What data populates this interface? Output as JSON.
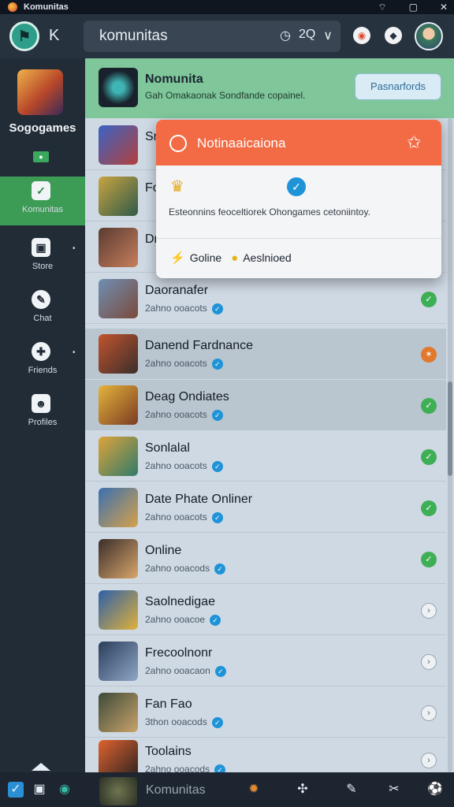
{
  "titlebar": {
    "title": "Komunitas",
    "controls": [
      "wifi-icon",
      "restore-icon",
      "close-icon"
    ]
  },
  "header": {
    "back_label": "K",
    "search_text": "komunitas",
    "search_icons": [
      "clock-icon",
      "2Q",
      "chevron-down-icon"
    ]
  },
  "sidebar": {
    "game_title": "Sogogames",
    "nav": [
      {
        "label": "Komunitas",
        "icon": "check-icon",
        "active": true
      },
      {
        "label": "Store",
        "icon": "store-icon",
        "active": false
      },
      {
        "label": "Chat",
        "icon": "chat-icon",
        "active": false
      },
      {
        "label": "Friends",
        "icon": "friends-icon",
        "active": false
      },
      {
        "label": "Profiles",
        "icon": "profile-icon",
        "active": false
      }
    ]
  },
  "top_card": {
    "title": "Nomunita",
    "subtitle": "Gah Omakaonak Sondfande copainel.",
    "button": "Pasnarfords"
  },
  "list": [
    {
      "name": "Sr",
      "sub": "",
      "status": "none"
    },
    {
      "name": "Fo",
      "sub": "",
      "status": "none"
    },
    {
      "name": "Dr",
      "sub": "",
      "status": "none"
    },
    {
      "name": "Daoranafer",
      "sub": "2ahno ooacots",
      "status": "on"
    },
    {
      "name": "Danend Fardnance",
      "sub": "2ahno ooacots",
      "status": "warn"
    },
    {
      "name": "Deag Ondiates",
      "sub": "2ahno ooacots",
      "status": "on"
    },
    {
      "name": "Sonlalal",
      "sub": "2ahno ooacots",
      "status": "on"
    },
    {
      "name": "Date Phate Onliner",
      "sub": "2ahno ooacots",
      "status": "on"
    },
    {
      "name": "Online",
      "sub": "2ahno ooacods",
      "status": "on"
    },
    {
      "name": "Saolnedigae",
      "sub": "2ahno ooacoe",
      "status": "idle"
    },
    {
      "name": "Frecoolnonr",
      "sub": "2ahno ooacaon",
      "status": "idle"
    },
    {
      "name": "Fan Fao",
      "sub": "3thon ooacods",
      "status": "idle"
    },
    {
      "name": "Toolains",
      "sub": "2ahno ooacods",
      "status": "idle"
    }
  ],
  "popup": {
    "title": "Notinaaicaiona",
    "body": "Esteonnins feoceltiorek Ohongames cetoniintoy.",
    "footer_left": "Goline",
    "footer_right": "Aeslnioed"
  },
  "bottombar": {
    "label": "Komunitas"
  }
}
